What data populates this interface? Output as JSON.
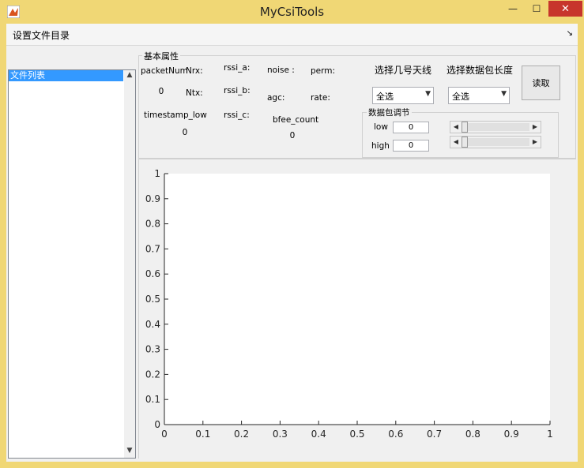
{
  "window": {
    "title": "MyCsiTools",
    "min_glyph": "—",
    "max_glyph": "☐",
    "close_glyph": "✕"
  },
  "menu": {
    "set_dir_label": "设置文件目录",
    "corner_glyph": "↘"
  },
  "file_list": {
    "title": "文件列表",
    "items": [
      "文件列表"
    ],
    "up_glyph": "▲",
    "down_glyph": "▼"
  },
  "props": {
    "title": "基本属性",
    "packetNum_label": "packetNum",
    "packetNum_value": "0",
    "nrx_label": "Nrx:",
    "ntx_label": "Ntx:",
    "rssi_a_label": "rssi_a:",
    "rssi_b_label": "rssi_b:",
    "rssi_c_label": "rssi_c:",
    "noise_label": "noise :",
    "agc_label": "agc:",
    "perm_label": "perm:",
    "rate_label": "rate:",
    "timestamp_label": "timestamp_low",
    "timestamp_value": "0",
    "bfee_label": "bfee_count",
    "bfee_value": "0"
  },
  "antenna": {
    "label": "选择几号天线",
    "selected": "全选",
    "arrow": "▼"
  },
  "packet_len": {
    "label": "选择数据包长度",
    "selected": "全选",
    "arrow": "▼"
  },
  "read_button": "读取",
  "adjust": {
    "title": "数据包调节",
    "low_label": "low",
    "low_value": "0",
    "high_label": "high",
    "high_value": "0",
    "low_slider_fraction": 0,
    "high_slider_fraction": 0
  },
  "chart_data": {
    "type": "line",
    "series": [],
    "xlim": [
      0,
      1
    ],
    "ylim": [
      0,
      1
    ],
    "x_ticks": [
      "0",
      "0.1",
      "0.2",
      "0.3",
      "0.4",
      "0.5",
      "0.6",
      "0.7",
      "0.8",
      "0.9",
      "1"
    ],
    "y_ticks": [
      "0",
      "0.1",
      "0.2",
      "0.3",
      "0.4",
      "0.5",
      "0.6",
      "0.7",
      "0.8",
      "0.9",
      "1"
    ],
    "grid": false
  },
  "colors": {
    "frame": "#f0d775",
    "close": "#c7352c",
    "selection": "#3399ff"
  }
}
